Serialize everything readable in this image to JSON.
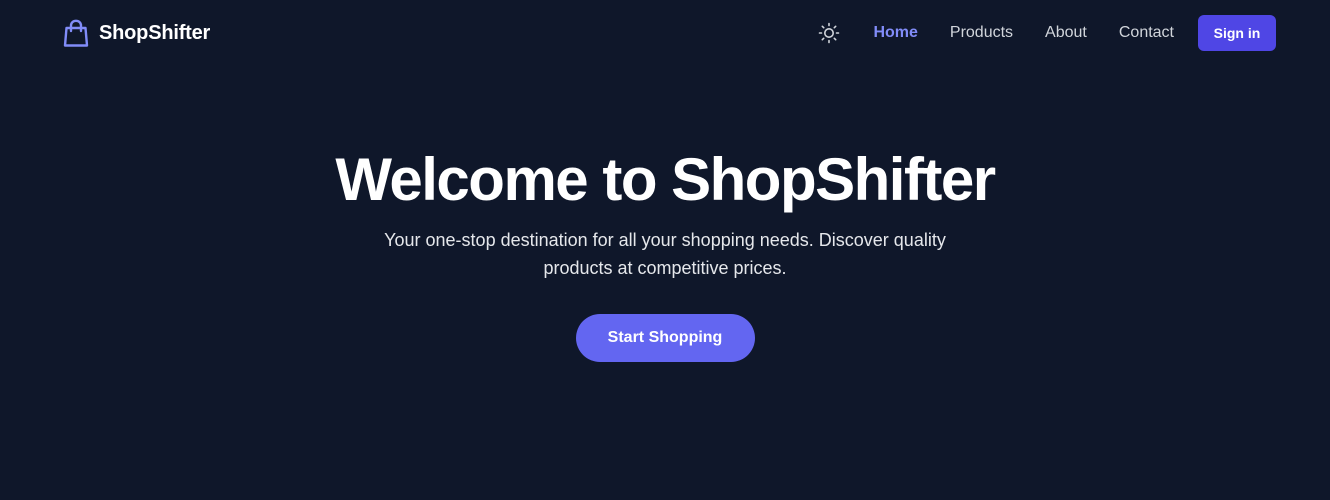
{
  "brand": {
    "name": "ShopShifter",
    "icon": "shopping-bag-icon",
    "accent_color": "#818cf8"
  },
  "nav": {
    "theme_toggle_icon": "sun-icon",
    "links": [
      {
        "label": "Home",
        "active": true
      },
      {
        "label": "Products",
        "active": false
      },
      {
        "label": "About",
        "active": false
      },
      {
        "label": "Contact",
        "active": false
      }
    ],
    "signin_label": "Sign in",
    "signin_color": "#4f46e5"
  },
  "hero": {
    "title": "Welcome to ShopShifter",
    "subtitle": "Your one-stop destination for all your shopping needs. Discover quality products at competitive prices.",
    "cta_label": "Start Shopping",
    "cta_color": "#6366f1"
  },
  "colors": {
    "background": "#0f172a",
    "active_link": "#818cf8",
    "link": "#d1d5db"
  }
}
